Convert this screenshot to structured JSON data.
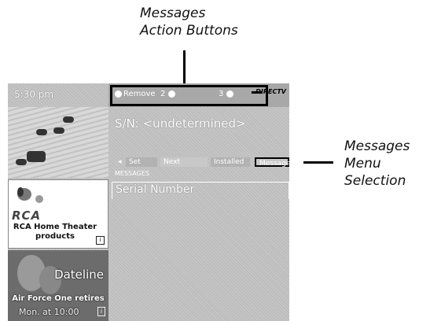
{
  "callouts": {
    "top": {
      "line1": "Messages",
      "line2": "Action Buttons"
    },
    "right": {
      "line1": "Messages",
      "line2": "Menu",
      "line3": "Selection"
    }
  },
  "screen": {
    "time": "5:30 pm",
    "action_bar": {
      "remove_label": "Remove",
      "button2_label": "2",
      "button3_label": "3",
      "corner_logo": "DIRECTV"
    },
    "serial_line": "S/N: <undetermined>",
    "tabs": [
      {
        "label": "◂"
      },
      {
        "label": "Set"
      },
      {
        "label": "Next"
      },
      {
        "label": "Installed"
      },
      {
        "label": "Messages"
      }
    ],
    "section_label": "MESSAGES",
    "field_label": "Serial Number",
    "ad": {
      "logo": "RCA",
      "caption_line1": "RCA Home Theater",
      "caption_line2": "products",
      "badge": "i"
    },
    "promo": {
      "title": "Dateline",
      "line1": "Air Force One retires",
      "line2": "Mon. at 10:00",
      "badge": "i"
    }
  }
}
